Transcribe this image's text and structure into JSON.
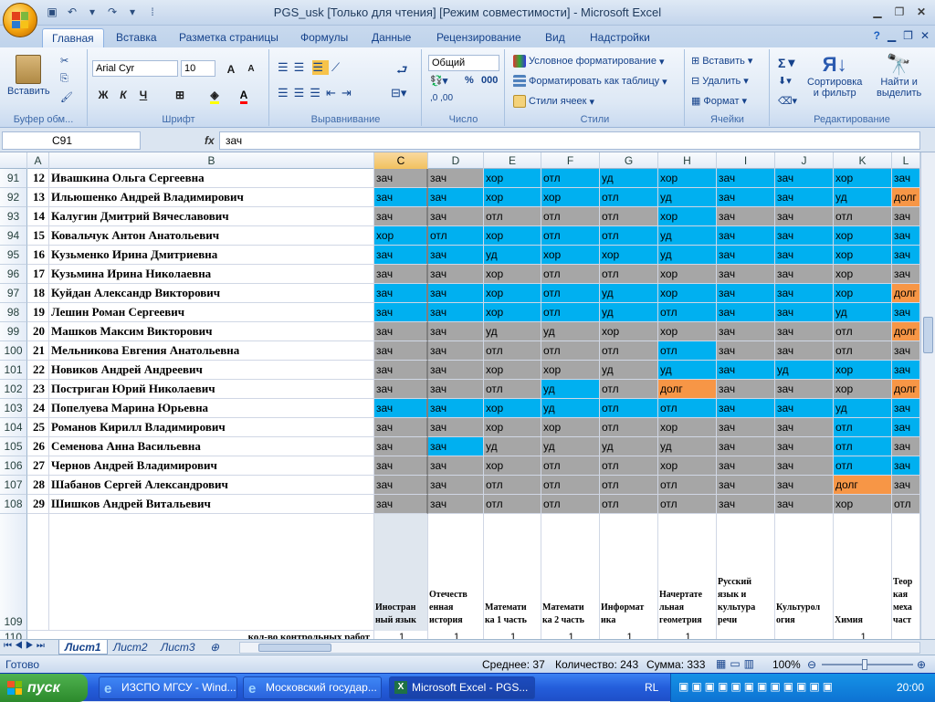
{
  "window": {
    "title": "PGS_usk  [Только для чтения]  [Режим совместимости] - Microsoft Excel"
  },
  "ribbon_tabs": [
    "Главная",
    "Вставка",
    "Разметка страницы",
    "Формулы",
    "Данные",
    "Рецензирование",
    "Вид",
    "Надстройки"
  ],
  "ribbon": {
    "clipboard": {
      "paste": "Вставить",
      "label": "Буфер обм..."
    },
    "font": {
      "name": "Arial Cyr",
      "size": "10",
      "bold": "Ж",
      "italic": "К",
      "underline": "Ч",
      "label": "Шрифт"
    },
    "alignment": {
      "label": "Выравнивание"
    },
    "number": {
      "format": "Общий",
      "label": "Число",
      "percent": "%",
      "thousands": "000"
    },
    "styles": {
      "conditional": "Условное форматирование",
      "as_table": "Форматировать как таблицу",
      "cell_styles": "Стили ячеек",
      "label": "Стили"
    },
    "cells": {
      "insert": "Вставить",
      "delete": "Удалить",
      "format": "Формат",
      "label": "Ячейки"
    },
    "editing": {
      "sigma": "Σ",
      "sort": "Сортировка\nи фильтр",
      "find": "Найти и\nвыделить",
      "label": "Редактирование"
    }
  },
  "formula_bar": {
    "name_box": "C91",
    "fx": "fx",
    "content": "зач"
  },
  "columns": [
    "A",
    "B",
    "C",
    "D",
    "E",
    "F",
    "G",
    "H",
    "I",
    "J",
    "K",
    "L"
  ],
  "rows": [
    {
      "r": "91",
      "n": "12",
      "name": "Ивашкина Ольга Сергеевна",
      "cells": [
        "зач",
        "зач",
        "хор",
        "отл",
        "уд",
        "хор",
        "зач",
        "зач",
        "хор",
        "зач"
      ]
    },
    {
      "r": "92",
      "n": "13",
      "name": "Ильюшенко Андрей Владимирович",
      "cells": [
        "зач",
        "зач",
        "хор",
        "хор",
        "отл",
        "уд",
        "зач",
        "зач",
        "уд",
        "долг"
      ]
    },
    {
      "r": "93",
      "n": "14",
      "name": "Калугин Дмитрий Вячеславович",
      "cells": [
        "зач",
        "зач",
        "отл",
        "отл",
        "отл",
        "хор",
        "зач",
        "зач",
        "отл",
        "зач"
      ]
    },
    {
      "r": "94",
      "n": "15",
      "name": "Ковальчук Антон Анатольевич",
      "cells": [
        "хор",
        "отл",
        "хор",
        "отл",
        "отл",
        "уд",
        "зач",
        "зач",
        "хор",
        "зач"
      ]
    },
    {
      "r": "95",
      "n": "16",
      "name": "Кузьменко Ирина Дмитриевна",
      "cells": [
        "зач",
        "зач",
        "уд",
        "хор",
        "хор",
        "уд",
        "зач",
        "зач",
        "хор",
        "зач"
      ]
    },
    {
      "r": "96",
      "n": "17",
      "name": "Кузьмина Ирина Николаевна",
      "cells": [
        "зач",
        "зач",
        "хор",
        "отл",
        "отл",
        "хор",
        "зач",
        "зач",
        "хор",
        "зач"
      ]
    },
    {
      "r": "97",
      "n": "18",
      "name": "Куйдан  Александр Викторович",
      "cells": [
        "зач",
        "зач",
        "хор",
        "отл",
        "уд",
        "хор",
        "зач",
        "зач",
        "хор",
        "долг"
      ]
    },
    {
      "r": "98",
      "n": "19",
      "name": "Лешин Роман Сергеевич",
      "cells": [
        "зач",
        "зач",
        "хор",
        "отл",
        "уд",
        "отл",
        "зач",
        "зач",
        "уд",
        "зач"
      ]
    },
    {
      "r": "99",
      "n": "20",
      "name": "Машков Максим Викторович",
      "cells": [
        "зач",
        "зач",
        "уд",
        "уд",
        "хор",
        "хор",
        "зач",
        "зач",
        "отл",
        "долг"
      ]
    },
    {
      "r": "100",
      "n": "21",
      "name": "Мельникова Евгения Анатольевна",
      "cells": [
        "зач",
        "зач",
        "отл",
        "отл",
        "отл",
        "отл",
        "зач",
        "зач",
        "отл",
        "зач"
      ]
    },
    {
      "r": "101",
      "n": "22",
      "name": "Новиков Андрей Андреевич",
      "cells": [
        "зач",
        "зач",
        "хор",
        "хор",
        "уд",
        "уд",
        "зач",
        "уд",
        "хор",
        "зач"
      ]
    },
    {
      "r": "102",
      "n": "23",
      "name": "Постриган Юрий Николаевич",
      "cells": [
        "зач",
        "зач",
        "отл",
        "уд",
        "отл",
        "долг",
        "зач",
        "зач",
        "хор",
        "долг"
      ]
    },
    {
      "r": "103",
      "n": "24",
      "name": "Попелуева Марина Юрьевна",
      "cells": [
        "зач",
        "зач",
        "хор",
        "уд",
        "отл",
        "отл",
        "зач",
        "зач",
        "уд",
        "зач"
      ]
    },
    {
      "r": "104",
      "n": "25",
      "name": "Романов Кирилл Владимирович",
      "cells": [
        "зач",
        "зач",
        "хор",
        "хор",
        "отл",
        "хор",
        "зач",
        "зач",
        "отл",
        "зач"
      ]
    },
    {
      "r": "105",
      "n": "26",
      "name": "Семенова Анна Васильевна",
      "cells": [
        "зач",
        "зач",
        "уд",
        "уд",
        "уд",
        "уд",
        "зач",
        "зач",
        "отл",
        "зач"
      ]
    },
    {
      "r": "106",
      "n": "27",
      "name": "Чернов Андрей Владимирович",
      "cells": [
        "зач",
        "зач",
        "хор",
        "отл",
        "отл",
        "хор",
        "зач",
        "зач",
        "отл",
        "зач"
      ]
    },
    {
      "r": "107",
      "n": "28",
      "name": "Шабанов Сергей Александрович",
      "cells": [
        "зач",
        "зач",
        "отл",
        "отл",
        "отл",
        "отл",
        "зач",
        "зач",
        "долг",
        "зач"
      ]
    },
    {
      "r": "108",
      "n": "29",
      "name": "Шишков Андрей Витальевич",
      "cells": [
        "зач",
        "зач",
        "отл",
        "отл",
        "отл",
        "отл",
        "зач",
        "зач",
        "хор",
        "отл"
      ]
    }
  ],
  "cell_colors": [
    [
      "g",
      "g",
      "b",
      "b",
      "b",
      "b",
      "b",
      "b",
      "b",
      "b"
    ],
    [
      "b",
      "b",
      "b",
      "b",
      "b",
      "b",
      "b",
      "b",
      "b",
      "o"
    ],
    [
      "g",
      "g",
      "g",
      "g",
      "g",
      "b",
      "g",
      "g",
      "g",
      "g"
    ],
    [
      "b",
      "b",
      "b",
      "b",
      "b",
      "b",
      "b",
      "b",
      "b",
      "b"
    ],
    [
      "b",
      "b",
      "b",
      "b",
      "b",
      "b",
      "b",
      "b",
      "b",
      "b"
    ],
    [
      "g",
      "g",
      "g",
      "g",
      "g",
      "g",
      "g",
      "g",
      "g",
      "g"
    ],
    [
      "b",
      "b",
      "b",
      "b",
      "b",
      "b",
      "b",
      "b",
      "b",
      "o"
    ],
    [
      "b",
      "b",
      "b",
      "b",
      "b",
      "b",
      "b",
      "b",
      "b",
      "b"
    ],
    [
      "g",
      "g",
      "g",
      "g",
      "g",
      "g",
      "g",
      "g",
      "g",
      "o"
    ],
    [
      "g",
      "g",
      "g",
      "g",
      "g",
      "b",
      "g",
      "g",
      "g",
      "g"
    ],
    [
      "g",
      "g",
      "g",
      "g",
      "g",
      "b",
      "b",
      "b",
      "b",
      "b"
    ],
    [
      "g",
      "g",
      "g",
      "b",
      "g",
      "o",
      "g",
      "g",
      "g",
      "o"
    ],
    [
      "b",
      "b",
      "b",
      "b",
      "b",
      "b",
      "b",
      "b",
      "b",
      "b"
    ],
    [
      "g",
      "g",
      "g",
      "g",
      "g",
      "g",
      "g",
      "g",
      "b",
      "b"
    ],
    [
      "g",
      "b",
      "g",
      "g",
      "g",
      "g",
      "g",
      "g",
      "b",
      "g"
    ],
    [
      "g",
      "g",
      "g",
      "g",
      "g",
      "g",
      "g",
      "g",
      "b",
      "b"
    ],
    [
      "g",
      "g",
      "g",
      "g",
      "g",
      "g",
      "g",
      "g",
      "o",
      "g"
    ],
    [
      "g",
      "g",
      "g",
      "g",
      "g",
      "g",
      "g",
      "g",
      "g",
      "g"
    ]
  ],
  "row109": {
    "r": "109",
    "headers": [
      "Иностран\nный язык",
      "Отечеств\nенная\nистория",
      "Математи\nка 1 часть",
      "Математи\nка 2 часть",
      "Информат\nика",
      "Начертате\nльная\nгеометрия",
      "Русский\nязык и\nкультура\nречи",
      "Культурол\nогия",
      "Химия",
      "Теор\nкая\nмеха\nчаст"
    ]
  },
  "row110": {
    "r": "110",
    "label": "кол-во контрольных работ",
    "values": [
      "1",
      "1",
      "1",
      "1",
      "1",
      "1",
      "",
      "",
      "1",
      ""
    ]
  },
  "sheets": [
    "Лист1",
    "Лист2",
    "Лист3"
  ],
  "status": {
    "ready": "Готово",
    "average": "Среднее: 37",
    "count": "Количество: 243",
    "sum": "Сумма: 333",
    "zoom": "100%"
  },
  "taskbar": {
    "start": "пуск",
    "tasks": [
      "ИЗСПО МГСУ - Wind...",
      "Московский государ...",
      "Microsoft Excel - PGS..."
    ],
    "lang": "RL",
    "time": "20:00"
  }
}
